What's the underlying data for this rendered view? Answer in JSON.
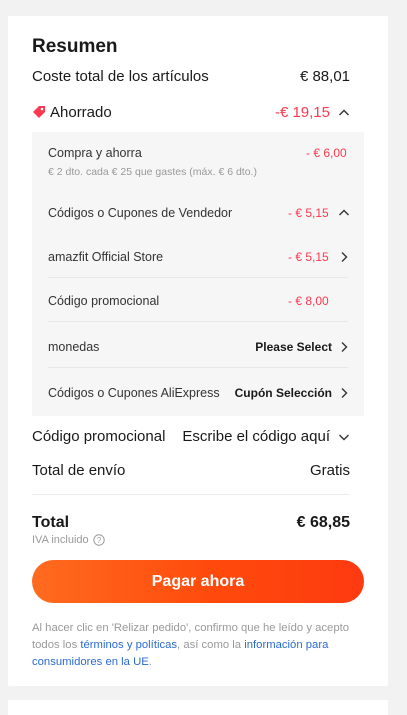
{
  "summary": {
    "title": "Resumen",
    "subtotal_label": "Coste total de los artículos",
    "subtotal_value": "€ 88,01",
    "saved_label": "Ahorrado",
    "saved_value": "-€ 19,15",
    "discounts": [
      {
        "label": "Compra y ahorra",
        "note": "€ 2 dto. cada € 25 que gastes (máx. € 6 dto.)",
        "amount": "- € 6,00"
      },
      {
        "label": "Códigos o Cupones de Vendedor",
        "amount": "- € 5,15"
      },
      {
        "label": "amazfit Official Store",
        "amount": "- € 5,15"
      },
      {
        "label": "Código promocional",
        "amount": "- € 8,00"
      },
      {
        "label": "monedas",
        "action": "Please Select"
      },
      {
        "label": "Códigos o Cupones AliExpress",
        "action": "Cupón Selección"
      }
    ],
    "promo_label": "Código promocional",
    "promo_action": "Escribe el código aquí",
    "shipping_label": "Total de envío",
    "shipping_value": "Gratis",
    "total_label": "Total",
    "total_value": "€ 68,85",
    "tax_note": "IVA incluido",
    "pay_button": "Pagar ahora",
    "legal_text_1": "Al hacer clic en 'Relizar pedido', confirmo que he leído y acepto todos los ",
    "legal_link_1": "términos y políticas",
    "legal_text_2": ", así como la ",
    "legal_link_2": "información para consumidores en la UE",
    "legal_text_3": "."
  },
  "colors": {
    "accent": "#fd384f",
    "button_gradient_start": "#ff6b1f",
    "button_gradient_end": "#fe3a10",
    "link": "#2b6cd0"
  }
}
